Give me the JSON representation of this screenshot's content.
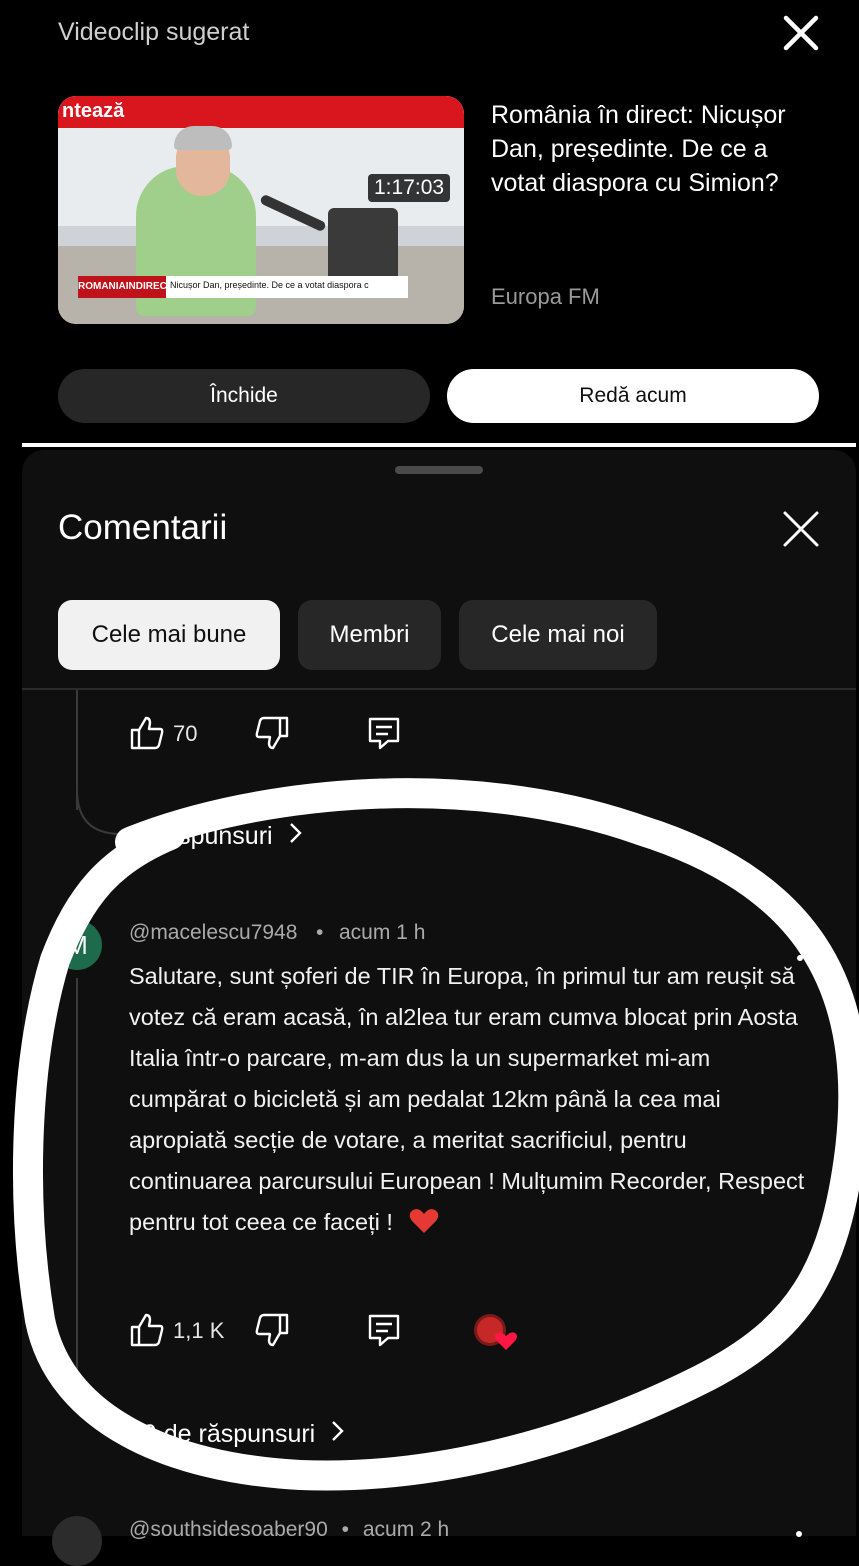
{
  "suggested": {
    "header": "Videoclip sugerat",
    "video_title": "România în direct: Nicușor Dan, președinte. De ce a votat diaspora cu Simion?",
    "channel": "Europa FM",
    "duration": "1:17:03",
    "thumbnail": {
      "banner_text": "ntează",
      "lower_third_logo": "ROMANIAINDIRECT",
      "lower_third_text": "Nicușor Dan, președinte. De ce a votat diaspora c"
    },
    "close_label": "Închide",
    "play_label": "Redă acum"
  },
  "comments": {
    "title": "Comentarii",
    "filters": [
      "Cele mai bune",
      "Membri",
      "Cele mai noi"
    ],
    "previous_comment": {
      "likes": "70",
      "replies_label": "o răspunsuri"
    },
    "comment": {
      "avatar_letter": "M",
      "author": "@macelescu7948",
      "time": "acum 1 h",
      "text": "Salutare, sunt șoferi de TIR în Europa, în primul tur am reușit să votez că eram acasă, în al2lea tur eram cumva blocat prin Aosta Italia într-o parcare, m-am dus la un supermarket mi-am cumpărat o bicicletă și am pedalat 12km până la cea mai apropiată secție de votare, a meritat sacrificiul, pentru continuarea parcursului European ! Mulțumim Recorder, Respect pentru tot ceea ce faceți !",
      "likes": "1,1 K",
      "replies_label": "79 de răspunsuri"
    },
    "next_comment": {
      "author": "@southsidesoaber90",
      "time": "acum 2 h"
    }
  },
  "colors": {
    "background": "#000000",
    "sheet": "#0f0f0f",
    "chip": "#272727",
    "heart": "#e53935",
    "avatar": "#1d6b4c"
  }
}
